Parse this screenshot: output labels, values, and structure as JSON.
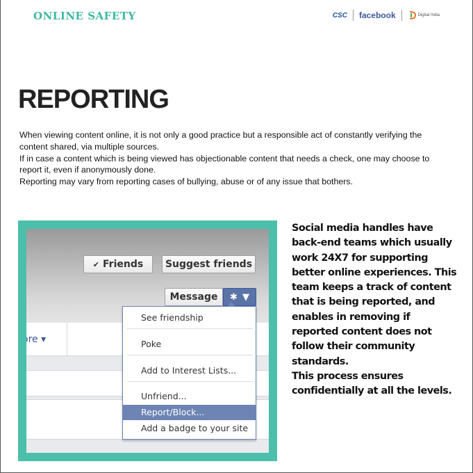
{
  "header": {
    "title": "ONLINE SAFETY",
    "logos": {
      "csc": "CSC",
      "facebook": "facebook",
      "digital_india": "Digital India"
    }
  },
  "main": {
    "heading": "REPORTING",
    "intro": [
      "When viewing content online, it is not only a good practice but a responsible act of constantly verifying the content shared, via multiple sources.",
      "If in case a content which is being viewed has objectionable content that needs a check, one may choose to report it, even if anonymously done.",
      "Reporting may vary from reporting cases of bullying, abuse or of any issue that bothers."
    ]
  },
  "screenshot": {
    "friends_label": "Friends",
    "suggest_label": "Suggest friends",
    "message_label": "Message",
    "more_tab_label": "ore ▾",
    "menu_items": [
      "See friendship",
      "Poke",
      "Add to Interest Lists...",
      "Unfriend...",
      "Report/Block...",
      "Add a badge to your site"
    ],
    "selected_item": "Report/Block..."
  },
  "side": {
    "paragraph1": "Social media handles have back-end teams which usually work 24X7 for supporting better online experiences. This team keeps a track of content that is being reported, and enables in removing if reported content does not follow their community standards.",
    "paragraph2": "This process ensures confidentially at all the levels."
  },
  "colors": {
    "accent": "#3fb8a2",
    "frame": "#4bbfa9",
    "fb_blue": "#3b5998",
    "menu_highlight": "#6d84b4"
  }
}
